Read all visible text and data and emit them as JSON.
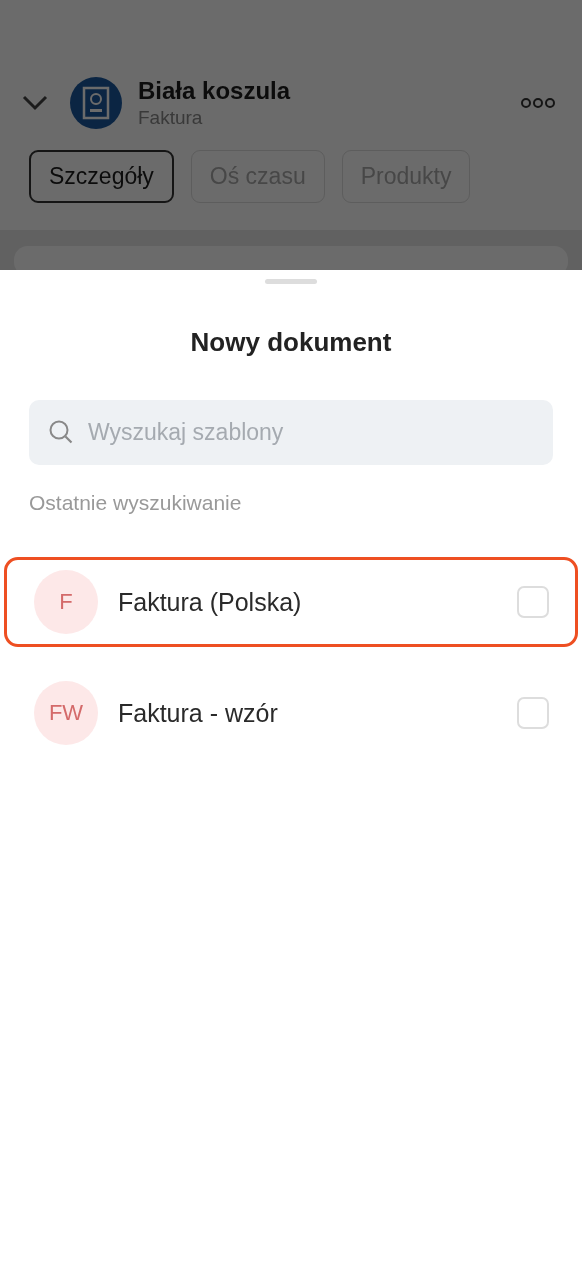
{
  "background": {
    "title": "Biała koszula",
    "subtitle": "Faktura",
    "tabs": [
      {
        "label": "Szczegóły",
        "selected": true
      },
      {
        "label": "Oś czasu",
        "selected": false
      },
      {
        "label": "Produkty",
        "selected": false
      }
    ]
  },
  "sheet": {
    "title": "Nowy dokument",
    "search": {
      "placeholder": "Wyszukaj szablony"
    },
    "section_label": "Ostatnie wyszukiwanie",
    "templates": [
      {
        "initials": "F",
        "name": "Faktura (Polska)",
        "checked": false,
        "highlighted": true
      },
      {
        "initials": "FW",
        "name": "Faktura - wzór",
        "checked": false,
        "highlighted": false
      }
    ]
  }
}
